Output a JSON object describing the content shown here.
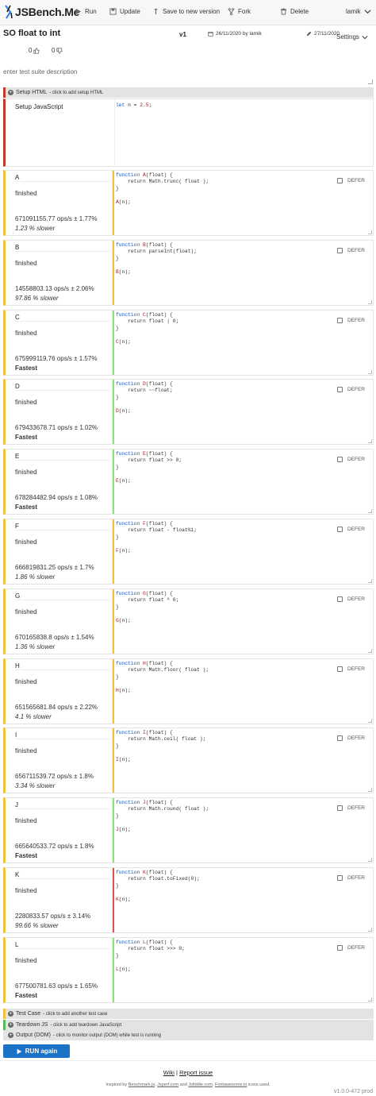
{
  "nav": {
    "logo": "JSBench.Me",
    "run": "Run",
    "update": "Update",
    "save_new": "Save to new version",
    "fork": "Fork",
    "delete": "Delete",
    "user": "lamik"
  },
  "header": {
    "title": "SO float to int",
    "version": "v1",
    "created": "26/11/2020 by lamik",
    "updated": "27/11/2020",
    "settings": "Settings",
    "likes": "0",
    "dislikes": "0",
    "description_placeholder": "enter test suite description"
  },
  "setup_html": {
    "label": "Setup HTML",
    "hint": "- click to add setup HTML"
  },
  "setup_js": {
    "label": "Setup JavaScript",
    "code": "let n = 2.5;"
  },
  "tests": [
    {
      "name": "A",
      "status": "finished",
      "ops": "671091155.77 ops/s ± 1.77%",
      "rel": "1.23 % slower",
      "fastest": false,
      "fn": "A",
      "body": "return Math.trunc( float );",
      "defer": "DEFER",
      "color": "#f0c23c"
    },
    {
      "name": "B",
      "status": "finished",
      "ops": "14558803.13 ops/s ± 2.06%",
      "rel": "97.86 % slower",
      "fastest": false,
      "fn": "B",
      "body": "return parseInt(float);",
      "defer": "DEFER",
      "color": "#f0c23c"
    },
    {
      "name": "C",
      "status": "finished",
      "ops": "675999119.76 ops/s ± 1.57%",
      "rel": "Fastest",
      "fastest": true,
      "fn": "C",
      "body": "return float | 0;",
      "defer": "DEFER",
      "color": "#8ee07a"
    },
    {
      "name": "D",
      "status": "finished",
      "ops": "679433678.71 ops/s ± 1.02%",
      "rel": "Fastest",
      "fastest": true,
      "fn": "D",
      "body": "return ~~float;",
      "defer": "DEFER",
      "color": "#8ee07a"
    },
    {
      "name": "E",
      "status": "finished",
      "ops": "678284482.94 ops/s ± 1.08%",
      "rel": "Fastest",
      "fastest": true,
      "fn": "E",
      "body": "return float >> 0;",
      "defer": "DEFER",
      "color": "#8ee07a"
    },
    {
      "name": "F",
      "status": "finished",
      "ops": "666819831.25 ops/s ± 1.7%",
      "rel": "1.86 % slower",
      "fastest": false,
      "fn": "F",
      "body": "return float - float%1;",
      "defer": "DEFER",
      "color": "#f0c23c"
    },
    {
      "name": "G",
      "status": "finished",
      "ops": "670165838.8 ops/s ± 1.54%",
      "rel": "1.36 % slower",
      "fastest": false,
      "fn": "G",
      "body": "return float ^ 0;",
      "defer": "DEFER",
      "color": "#f0c23c"
    },
    {
      "name": "H",
      "status": "finished",
      "ops": "651565681.84 ops/s ± 2.22%",
      "rel": "4.1 % slower",
      "fastest": false,
      "fn": "H",
      "body": "return Math.floor( float );",
      "defer": "DEFER",
      "color": "#f0c23c"
    },
    {
      "name": "I",
      "status": "finished",
      "ops": "656711539.72 ops/s ± 1.8%",
      "rel": "3.34 % slower",
      "fastest": false,
      "fn": "I",
      "body": "return Math.ceil( float );",
      "defer": "DEFER",
      "color": "#f0c23c"
    },
    {
      "name": "J",
      "status": "finished",
      "ops": "665640533.72 ops/s ± 1.8%",
      "rel": "Fastest",
      "fastest": true,
      "fn": "J",
      "body": "return Math.round( float );",
      "defer": "DEFER",
      "color": "#8ee07a"
    },
    {
      "name": "K",
      "status": "finished",
      "ops": "2280833.57 ops/s ± 3.14%",
      "rel": "99.66 % slower",
      "fastest": false,
      "fn": "K",
      "body": "return float.toFixed(0);",
      "defer": "DEFER",
      "color": "#d9534f"
    },
    {
      "name": "L",
      "status": "finished",
      "ops": "677500781.63 ops/s ± 1.65%",
      "rel": "Fastest",
      "fastest": true,
      "fn": "L",
      "body": "return float >>> 0;",
      "defer": "DEFER",
      "color": "#8ee07a"
    }
  ],
  "bottom_bars": [
    {
      "label": "Test Case",
      "hint": "- click to add another test case",
      "color": "#f0c23c"
    },
    {
      "label": "Teardown JS",
      "hint": "- click to add teardown JavaScript",
      "color": "#5cb85c"
    },
    {
      "label": "Output (DOM)",
      "hint": "- click to monitor output (DOM) while test is running",
      "color": "#e3e3e3"
    }
  ],
  "run_again": "RUN again",
  "footer": {
    "wiki": "Wiki",
    "sep": "|",
    "report": "Report issue",
    "credits_pre": "Inspired by",
    "c1": "Benchmark.js",
    "c2": "Jsperf.com",
    "c_and": "and",
    "c3": "Jsfiddle.com",
    "c4": "Fontawesome.io",
    "credits_post": "icons used.",
    "version": "v1.0.0-472 prod"
  }
}
